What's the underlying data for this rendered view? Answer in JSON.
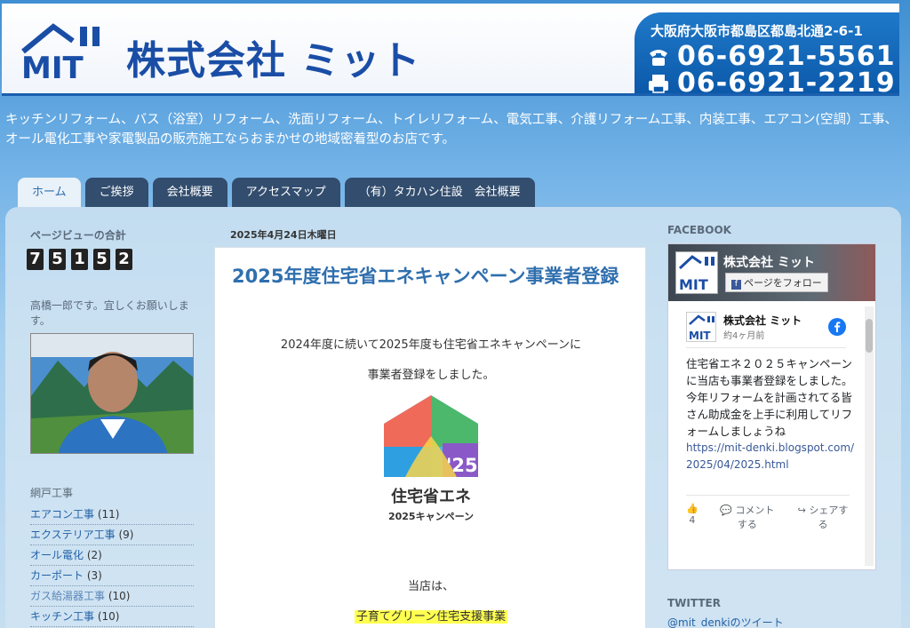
{
  "header": {
    "company_name": "株式会社 ミット",
    "address": "大阪府大阪市都島区都島北通2-6-1",
    "tel": "06-6921-5561",
    "fax": "06-6921-2219"
  },
  "tagline": "キッチンリフォーム、バス（浴室）リフォーム、洗面リフォーム、トイレリフォーム、電気工事、介護リフォーム工事、内装工事、エアコン(空調）工事、オール電化工事や家電製品の販売施工ならおまかせの地域密着型のお店です。",
  "tabs": [
    "ホーム",
    "ご挨拶",
    "会社概要",
    "アクセスマップ",
    "（有）タカハシ住設　会社概要"
  ],
  "sidebar": {
    "pageviews_title": "ページビューの合計",
    "pageviews_digits": [
      "7",
      "5",
      "1",
      "5",
      "2"
    ],
    "greeting": "高橋一郎です。宜しくお願いします。",
    "labels_title": "網戸工事",
    "labels": [
      {
        "name": "エアコン工事",
        "count": "(11)"
      },
      {
        "name": "エクステリア工事",
        "count": "(9)"
      },
      {
        "name": "オール電化",
        "count": "(2)"
      },
      {
        "name": "カーポート",
        "count": "(3)"
      },
      {
        "name": "ガス給湯器工事",
        "count": "(10)"
      },
      {
        "name": "キッチン工事",
        "count": "(10)"
      }
    ]
  },
  "post": {
    "date": "2025年4月24日木曜日",
    "title": "2025年度住宅省エネキャンペーン事業者登録",
    "line1": "2024年度に続いて2025年度も住宅省エネキャンペーンに",
    "line2": "事業者登録をしました。",
    "campaign_year": "'25",
    "campaign_name": "住宅省エネ",
    "campaign_sub": "2025キャンペーン",
    "line3": "当店は、",
    "highlight": "子育てグリーン住宅支援事業"
  },
  "right": {
    "facebook_title": "FACEBOOK",
    "fb_page_name": "株式会社 ミット",
    "fb_follow": "ページをフォロー",
    "fb_post_time": "約4ヶ月前",
    "fb_text": "住宅省エネ２０２５キャンペーンに当店も事業者登録をしました。今年リフォームを計画されてる皆さん助成金を上手に利用してリフォームしましょうね",
    "fb_link": "https://mit-denki.blogspot.com/2025/04/2025.html",
    "fb_like_count": "4",
    "fb_comment": "コメントする",
    "fb_share": "シェアする",
    "twitter_title": "TWITTER",
    "twitter_link": "@mit_denkiのツイート"
  },
  "colors": {
    "brand_blue": "#1a4ea6",
    "tab_dark": "#324d6e",
    "link": "#2262a8",
    "title": "#2f6fae",
    "highlight": "#ffff50"
  }
}
